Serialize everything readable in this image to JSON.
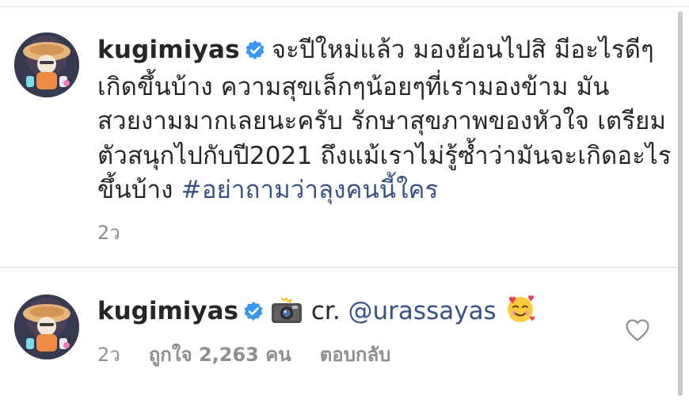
{
  "caption": {
    "username": "kugimiyas",
    "text": "จะปีใหม่แล้ว มองย้อนไปสิ มีอะไรดีๆ เกิดขึ้นบ้าง ความสุขเล็กๆน้อยๆที่เรามองข้าม มันสวยงามมากเลยนะครับ รักษาสุขภาพของหัวใจ เตรียมตัวสนุกไปกับปี2021 ถึงแม้เราไม่รู้ซ้ำว่ามันจะเกิดอะไรขึ้นบ้าง ",
    "hashtag": "#อย่าถามว่าลุงคนนี้ใคร",
    "time": "2ว"
  },
  "reply": {
    "username": "kugimiyas",
    "prefix": "cr. ",
    "mention": "@urassayas",
    "time": "2ว",
    "likes": "ถูกใจ 2,263 คน",
    "reply_label": "ตอบกลับ"
  },
  "icons": {
    "verified": "verified-badge-icon",
    "camera": "camera-flash-emoji",
    "smile": "smiling-face-with-hearts-emoji",
    "like": "heart-outline-icon"
  },
  "colors": {
    "verified": "#3897f0",
    "link": "#385185",
    "muted": "#8e8e8e"
  }
}
